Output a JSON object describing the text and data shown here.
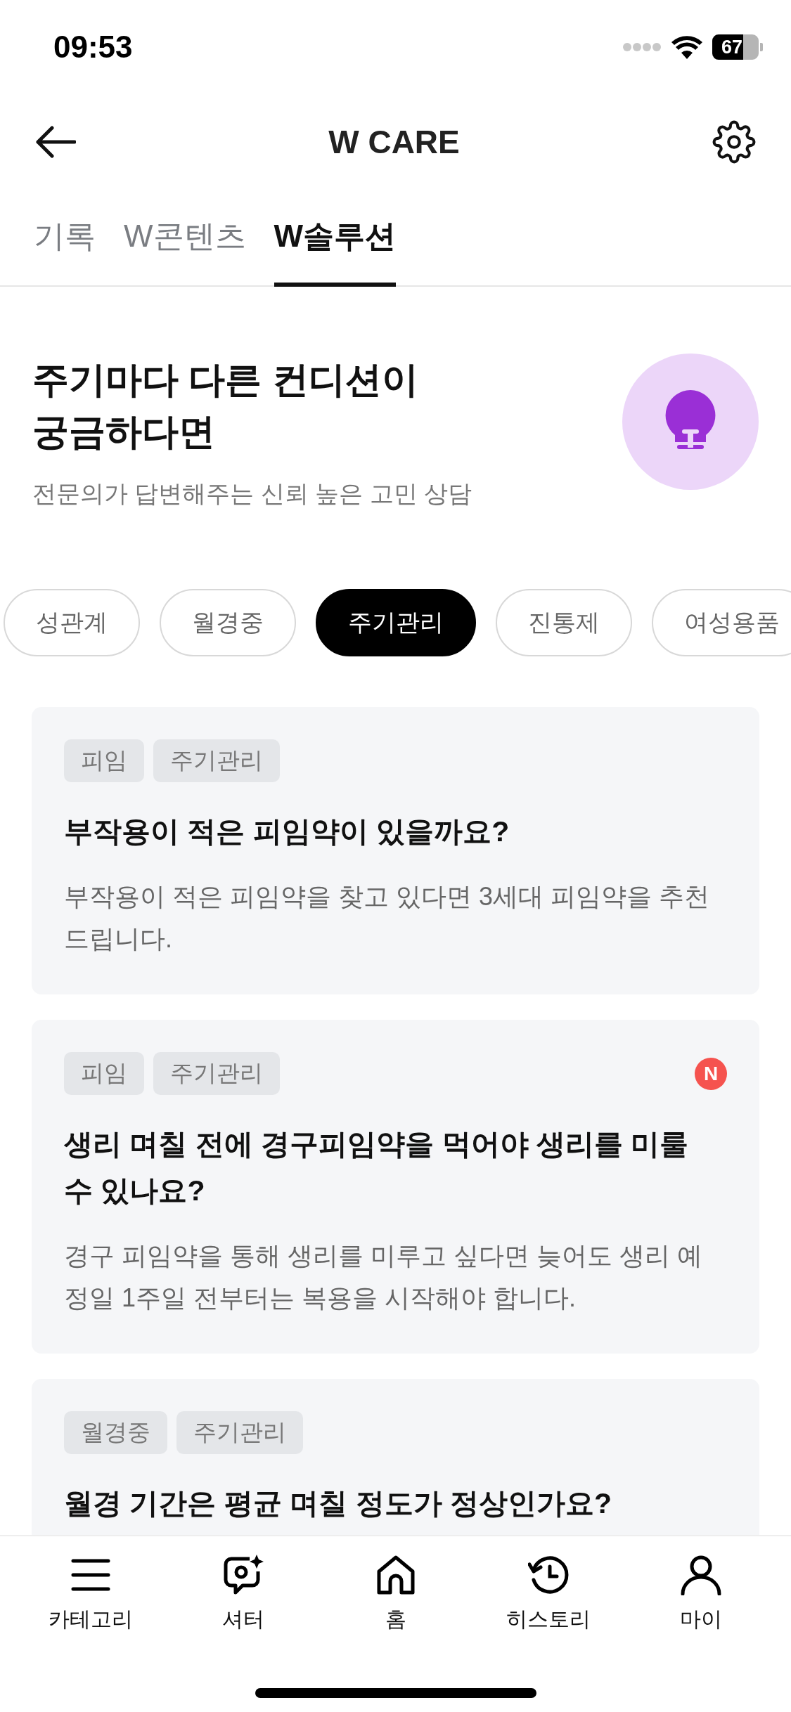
{
  "status_bar": {
    "time": "09:53",
    "battery": "67"
  },
  "header": {
    "title": "W CARE"
  },
  "tabs": [
    {
      "label": "기록",
      "selected": false
    },
    {
      "label": "W콘텐츠",
      "selected": false
    },
    {
      "label": "W솔루션",
      "selected": true
    }
  ],
  "hero": {
    "title_lines": [
      "주기마다 다른 컨디션이",
      "궁금하다면"
    ],
    "subtitle": "전문의가 답변해주는 신뢰 높은 고민 상담"
  },
  "categories": [
    {
      "label": "성관계",
      "selected": false
    },
    {
      "label": "월경중",
      "selected": false
    },
    {
      "label": "주기관리",
      "selected": true
    },
    {
      "label": "진통제",
      "selected": false
    },
    {
      "label": "여성용품",
      "selected": false
    }
  ],
  "questions": [
    {
      "tags": [
        "피임",
        "주기관리"
      ],
      "new": false,
      "title": "부작용이 적은 피임약이 있을까요?",
      "body": "부작용이 적은 피임약을 찾고 있다면 3세대 피임약을 추천드립니다."
    },
    {
      "tags": [
        "피임",
        "주기관리"
      ],
      "new": true,
      "badge": "N",
      "title": "생리 며칠 전에 경구피임약을 먹어야 생리를 미룰 수 있나요?",
      "body": "경구 피임약을 통해 생리를 미루고 싶다면 늦어도 생리 예정일 1주일 전부터는 복용을 시작해야 합니다."
    },
    {
      "tags": [
        "월경중",
        "주기관리"
      ],
      "new": false,
      "title": "월경 기간은 평균 며칠 정도가 정상인가요?"
    }
  ],
  "bottom_nav": [
    {
      "label": "카테고리",
      "kind": "menu"
    },
    {
      "label": "셔터",
      "kind": "camera"
    },
    {
      "label": "홈",
      "kind": "home"
    },
    {
      "label": "히스토리",
      "kind": "history"
    },
    {
      "label": "마이",
      "kind": "person"
    }
  ]
}
